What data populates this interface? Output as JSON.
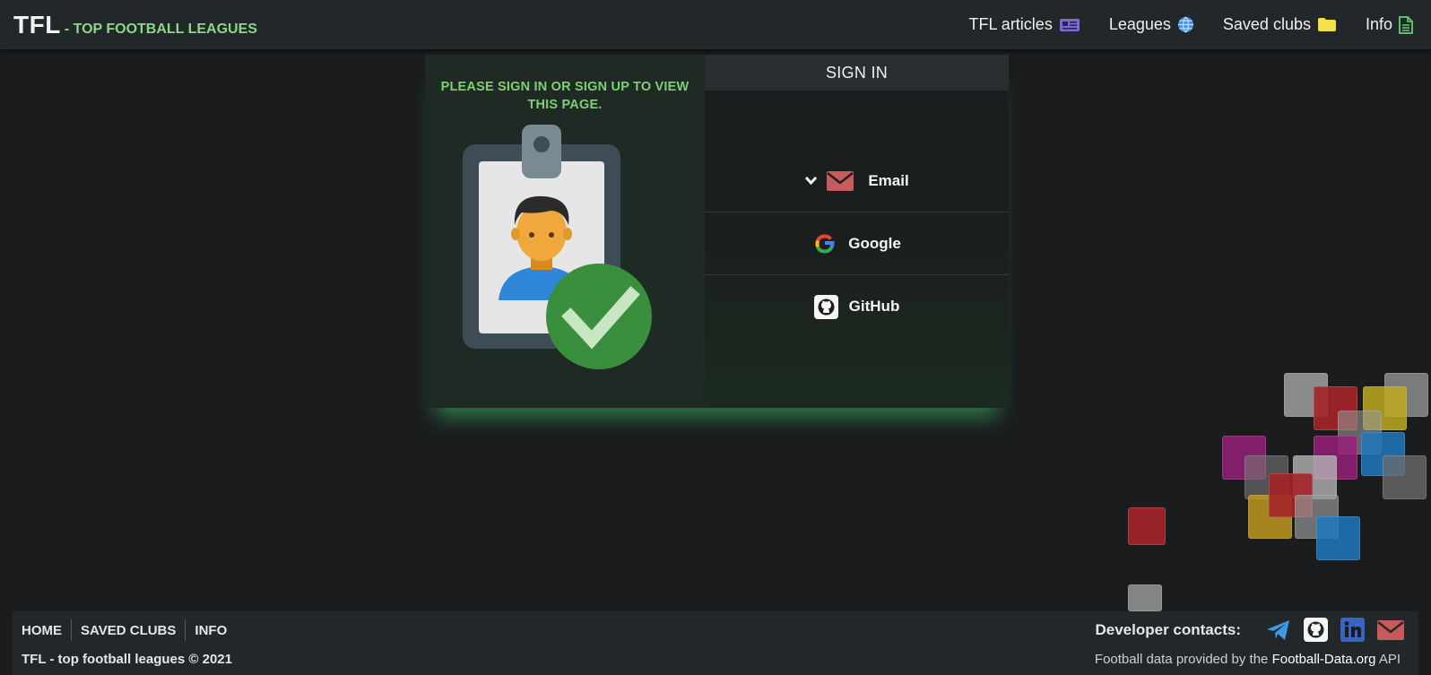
{
  "header": {
    "brand_main": "TFL",
    "brand_sub": "- TOP FOOTBALL LEAGUES",
    "nav": [
      {
        "label": "TFL articles",
        "icon": "newspaper-icon"
      },
      {
        "label": "Leagues",
        "icon": "globe-icon"
      },
      {
        "label": "Saved clubs",
        "icon": "folder-icon"
      },
      {
        "label": "Info",
        "icon": "document-icon"
      }
    ]
  },
  "card": {
    "notice": "PLEASE SIGN IN OR SIGN UP TO VIEW THIS PAGE.",
    "signin_title": "SIGN IN",
    "options": [
      {
        "label": "Email",
        "icon": "envelope-icon"
      },
      {
        "label": "Google",
        "icon": "google-icon"
      },
      {
        "label": "GitHub",
        "icon": "github-icon"
      }
    ]
  },
  "footer": {
    "links": [
      "HOME",
      "SAVED CLUBS",
      "INFO"
    ],
    "copyright": "TFL - top football leagues © 2021",
    "contacts_label": "Developer contacts:",
    "credit_prefix": "Football data provided by the",
    "credit_link": "Football-Data.org",
    "credit_suffix": "API"
  },
  "colors": {
    "background": "#1a1c1e",
    "header": "#22272a",
    "accent_green": "#8ed685",
    "card_glow": "#46c86e",
    "email_red": "#c75a5a",
    "telegram_blue": "#3c9be0",
    "linkedin_blue": "#3b63c4"
  }
}
